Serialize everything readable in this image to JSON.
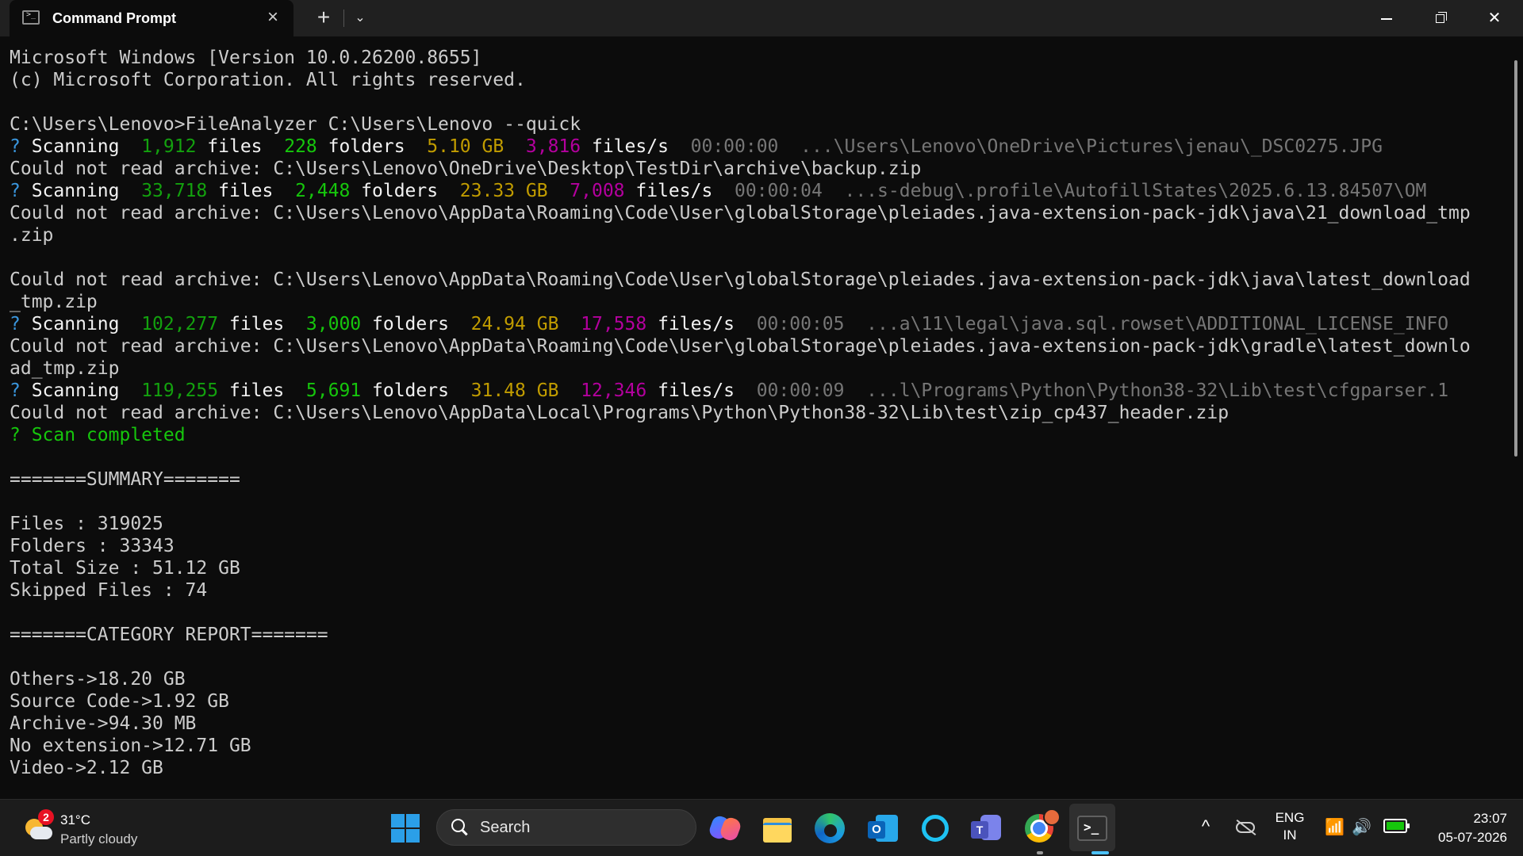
{
  "window": {
    "tab_title": "Command Prompt",
    "tab_icon_glyph": ">_",
    "new_tab_symbol": "+",
    "dropdown_symbol": "⌄",
    "close_tab_symbol": "×",
    "close_window_symbol": "✕"
  },
  "colors": {
    "background": "#0c0c0c",
    "text": "#cccccc",
    "green": "#16c60c",
    "dark_green": "#13a10e",
    "yellow": "#c19c00",
    "purple": "#b4009e",
    "gray": "#767676"
  },
  "terminal": {
    "lines": [
      [
        {
          "t": "Microsoft Windows [Version 10.0.26200.8655]"
        }
      ],
      [
        {
          "t": "(c) Microsoft Corporation. All rights reserved."
        }
      ],
      [],
      [
        {
          "t": "C:\\Users\\Lenovo>FileAnalyzer C:\\Users\\Lenovo --quick"
        }
      ],
      [
        {
          "t": "? ",
          "c": "cyan"
        },
        {
          "t": "Scanning  ",
          "c": "white"
        },
        {
          "t": "1,912",
          "c": "lgreen"
        },
        {
          "t": " files  ",
          "c": "white"
        },
        {
          "t": "228",
          "c": "green"
        },
        {
          "t": " folders  ",
          "c": "white"
        },
        {
          "t": "5.10 GB",
          "c": "yellow"
        },
        {
          "t": "  "
        },
        {
          "t": "3,816",
          "c": "purple"
        },
        {
          "t": " files/s  ",
          "c": "white"
        },
        {
          "t": "00:00:00  ...\\Users\\Lenovo\\OneDrive\\Pictures\\jenau\\_DSC0275.JPG",
          "c": "gray"
        }
      ],
      [
        {
          "t": "Could not read archive: C:\\Users\\Lenovo\\OneDrive\\Desktop\\TestDir\\archive\\backup.zip"
        }
      ],
      [
        {
          "t": "? ",
          "c": "cyan"
        },
        {
          "t": "Scanning  ",
          "c": "white"
        },
        {
          "t": "33,718",
          "c": "lgreen"
        },
        {
          "t": " files  ",
          "c": "white"
        },
        {
          "t": "2,448",
          "c": "green"
        },
        {
          "t": " folders  ",
          "c": "white"
        },
        {
          "t": "23.33 GB",
          "c": "yellow"
        },
        {
          "t": "  "
        },
        {
          "t": "7,008",
          "c": "purple"
        },
        {
          "t": " files/s  ",
          "c": "white"
        },
        {
          "t": "00:00:04  ...s-debug\\.profile\\AutofillStates\\2025.6.13.84507\\OM",
          "c": "gray"
        }
      ],
      [
        {
          "t": "Could not read archive: C:\\Users\\Lenovo\\AppData\\Roaming\\Code\\User\\globalStorage\\pleiades.java-extension-pack-jdk\\java\\21_download_tmp"
        }
      ],
      [
        {
          "t": ".zip"
        }
      ],
      [],
      [
        {
          "t": "Could not read archive: C:\\Users\\Lenovo\\AppData\\Roaming\\Code\\User\\globalStorage\\pleiades.java-extension-pack-jdk\\java\\latest_download"
        }
      ],
      [
        {
          "t": "_tmp.zip"
        }
      ],
      [
        {
          "t": "? ",
          "c": "cyan"
        },
        {
          "t": "Scanning  ",
          "c": "white"
        },
        {
          "t": "102,277",
          "c": "lgreen"
        },
        {
          "t": " files  ",
          "c": "white"
        },
        {
          "t": "3,000",
          "c": "green"
        },
        {
          "t": " folders  ",
          "c": "white"
        },
        {
          "t": "24.94 GB",
          "c": "yellow"
        },
        {
          "t": "  "
        },
        {
          "t": "17,558",
          "c": "purple"
        },
        {
          "t": " files/s  ",
          "c": "white"
        },
        {
          "t": "00:00:05  ...a\\11\\legal\\java.sql.rowset\\ADDITIONAL_LICENSE_INFO",
          "c": "gray"
        }
      ],
      [
        {
          "t": "Could not read archive: C:\\Users\\Lenovo\\AppData\\Roaming\\Code\\User\\globalStorage\\pleiades.java-extension-pack-jdk\\gradle\\latest_downlo"
        }
      ],
      [
        {
          "t": "ad_tmp.zip"
        }
      ],
      [
        {
          "t": "? ",
          "c": "cyan"
        },
        {
          "t": "Scanning  ",
          "c": "white"
        },
        {
          "t": "119,255",
          "c": "lgreen"
        },
        {
          "t": " files  ",
          "c": "white"
        },
        {
          "t": "5,691",
          "c": "green"
        },
        {
          "t": " folders  ",
          "c": "white"
        },
        {
          "t": "31.48 GB",
          "c": "yellow"
        },
        {
          "t": "  "
        },
        {
          "t": "12,346",
          "c": "purple"
        },
        {
          "t": " files/s  ",
          "c": "white"
        },
        {
          "t": "00:00:09  ...l\\Programs\\Python\\Python38-32\\Lib\\test\\cfgparser.1",
          "c": "gray"
        }
      ],
      [
        {
          "t": "Could not read archive: C:\\Users\\Lenovo\\AppData\\Local\\Programs\\Python\\Python38-32\\Lib\\test\\zip_cp437_header.zip"
        }
      ],
      [
        {
          "t": "? Scan completed",
          "c": "green"
        }
      ],
      [],
      [
        {
          "t": "=======SUMMARY======="
        }
      ],
      [],
      [
        {
          "t": "Files : 319025"
        }
      ],
      [
        {
          "t": "Folders : 33343"
        }
      ],
      [
        {
          "t": "Total Size : 51.12 GB"
        }
      ],
      [
        {
          "t": "Skipped Files : 74"
        }
      ],
      [],
      [
        {
          "t": "=======CATEGORY REPORT======="
        }
      ],
      [],
      [
        {
          "t": "Others->18.20 GB"
        }
      ],
      [
        {
          "t": "Source Code->1.92 GB"
        }
      ],
      [
        {
          "t": "Archive->94.30 MB"
        }
      ],
      [
        {
          "t": "No extension->12.71 GB"
        }
      ],
      [
        {
          "t": "Video->2.12 GB"
        }
      ]
    ]
  },
  "taskbar": {
    "weather": {
      "badge": "2",
      "temp": "31°C",
      "desc": "Partly cloudy"
    },
    "search_label": "Search",
    "apps": [
      {
        "name": "copilot-icon"
      },
      {
        "name": "file-explorer-icon"
      },
      {
        "name": "edge-icon"
      },
      {
        "name": "outlook-icon",
        "glyph": "O"
      },
      {
        "name": "cortana-icon"
      },
      {
        "name": "teams-icon",
        "glyph": "T"
      },
      {
        "name": "chrome-icon"
      },
      {
        "name": "terminal-icon",
        "glyph": ">_"
      }
    ],
    "tray": {
      "chevron": "^",
      "lang_1": "ENG",
      "lang_2": "IN",
      "wifi": "📶",
      "volume": "🔊"
    },
    "clock": {
      "time": "23:07",
      "date": "05-07-2026"
    }
  }
}
